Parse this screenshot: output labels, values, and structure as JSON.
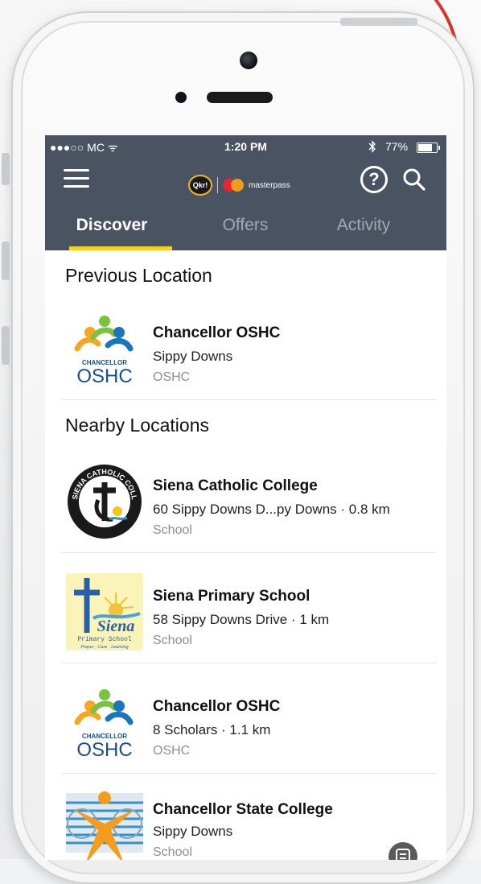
{
  "status_bar": {
    "carrier": "●●●○○ MC ᯤ",
    "time": "1:20 PM",
    "battery_pct": "77%",
    "battery_level": 0.77
  },
  "header": {
    "brand_qkr": "Qkr!",
    "brand_masterpass": "masterpass"
  },
  "tabs": [
    {
      "label": "Discover",
      "active": true
    },
    {
      "label": "Offers",
      "active": false
    },
    {
      "label": "Activity",
      "active": false
    }
  ],
  "previous": {
    "title": "Previous Location",
    "items": [
      {
        "name": "Chancellor OSHC",
        "address": "Sippy Downs",
        "category": "OSHC",
        "logo_text_small": "CHANCELLOR",
        "logo_text_big": "OSHC"
      }
    ]
  },
  "nearby": {
    "title": "Nearby Locations",
    "items": [
      {
        "name": "Siena Catholic College",
        "address": "60 Sippy Downs D...py Downs · 0.8 km",
        "category": "School",
        "logo_ring_text": "SIENA CATHOLIC COLLEGE"
      },
      {
        "name": "Siena Primary School",
        "address": "58 Sippy Downs Drive · 1 km",
        "category": "School",
        "logo_word": "Siena",
        "logo_sub": "Primary School",
        "logo_motto": "Prayer · Care · Learning"
      },
      {
        "name": "Chancellor OSHC",
        "address": "8 Scholars · 1.1 km",
        "category": "OSHC",
        "logo_text_small": "CHANCELLOR",
        "logo_text_big": "OSHC"
      },
      {
        "name": "Chancellor State College",
        "address": "Sippy Downs",
        "category": "School"
      }
    ]
  },
  "colors": {
    "header_bg": "#4a5361",
    "tab_indicator": "#f5d21f",
    "arrow": "#d9352b"
  },
  "icons": [
    "menu-icon",
    "help-icon",
    "search-icon",
    "wifi-icon",
    "bluetooth-icon",
    "battery-icon",
    "chat-icon"
  ]
}
